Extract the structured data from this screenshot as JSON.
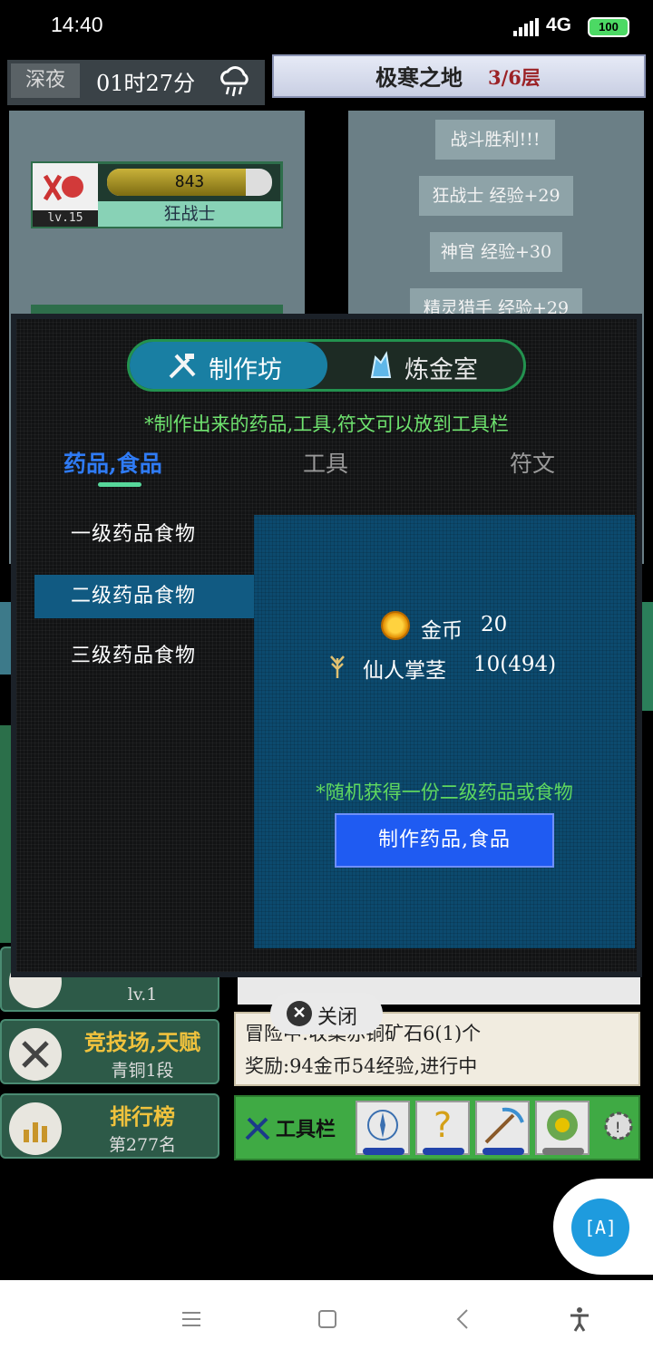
{
  "status_bar": {
    "time": "14:40",
    "network": "4G",
    "battery": "100"
  },
  "game": {
    "time_of_day": "深夜",
    "clock": "01时27分",
    "region": {
      "name": "极寒之地",
      "floor": "3/6层"
    },
    "hero": {
      "hp": "843",
      "hp_ratio": 0.84,
      "level": "lv.15",
      "name": "狂战士"
    },
    "battle_log": [
      "战斗胜利!!!",
      "狂战士 经验+29",
      "神官 经验+30",
      "精灵猎手 经验+29"
    ],
    "buttons": [
      {
        "title": "",
        "sub": "lv.1"
      },
      {
        "title": "竞技场,天赋",
        "sub": "青铜1段"
      },
      {
        "title": "排行榜",
        "sub": "第277名"
      }
    ],
    "quest": {
      "line1": "冒险中:收集赤铜矿石6(1)个",
      "line2": "奖励:94金币54经验,进行中"
    },
    "toolbar_label": "工具栏"
  },
  "dialog": {
    "tabs": {
      "workshop": "制作坊",
      "alchemy": "炼金室"
    },
    "hint": "*制作出来的药品,工具,符文可以放到工具栏",
    "categories": [
      "药品,食品",
      "工具",
      "符文"
    ],
    "sub_items": [
      "一级药品食物",
      "二级药品食物",
      "三级药品食物"
    ],
    "costs": {
      "gold_label": "金币",
      "gold_value": "20",
      "item_label": "仙人掌茎",
      "item_value": "10(494)"
    },
    "note": "*随机获得一份二级药品或食物",
    "craft_button": "制作药品,食品",
    "close_label": "关闭"
  },
  "float_button": "[A]",
  "colors": {
    "accent": "#197fa3",
    "hint_green": "#6fe36f",
    "craft_blue": "#1f5bf2",
    "selected": "#115a82"
  }
}
